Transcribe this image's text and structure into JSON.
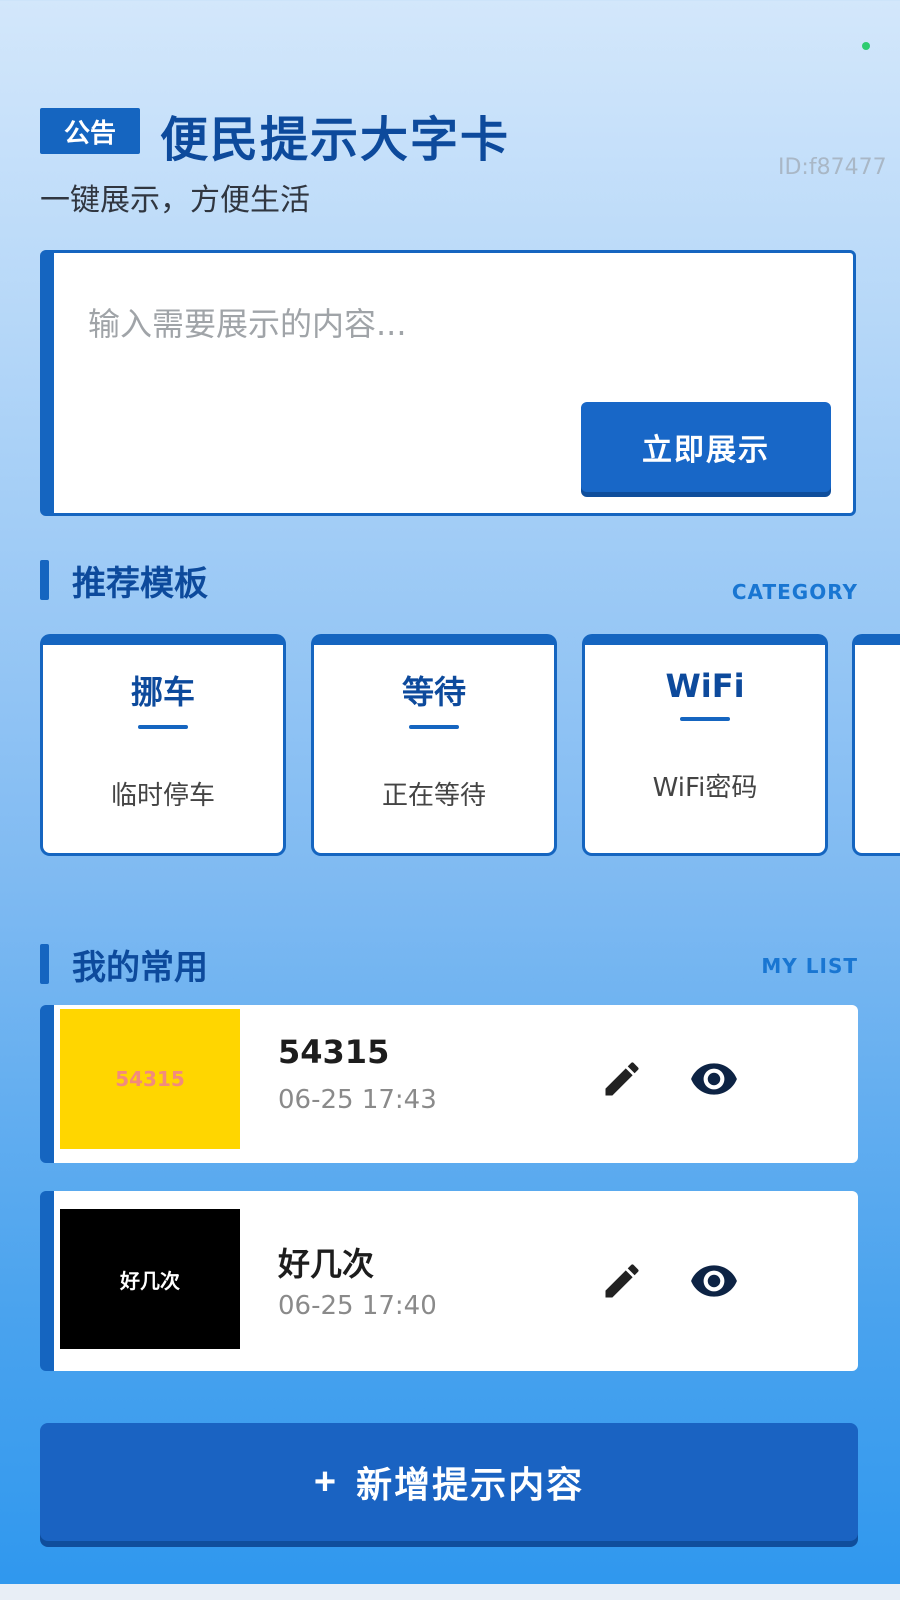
{
  "header": {
    "badge": "公告",
    "title": "便民提示大字卡",
    "subtitle": "一键展示，方便生活",
    "id_text": "ID:f87477"
  },
  "input_card": {
    "placeholder": "输入需要展示的内容...",
    "value": "",
    "button_label": "立即展示"
  },
  "templates_section": {
    "title": "推荐模板",
    "link": "CATEGORY",
    "items": [
      {
        "title": "挪车",
        "desc": "临时停车"
      },
      {
        "title": "等待",
        "desc": "正在等待"
      },
      {
        "title": "WiFi",
        "desc": "WiFi密码"
      }
    ]
  },
  "favorites_section": {
    "title": "我的常用",
    "link": "MY LIST",
    "items": [
      {
        "thumb_text": "54315",
        "thumb_bg": "#ffd600",
        "thumb_color": "#f28b7d",
        "name": "54315",
        "time": "06-25 17:43",
        "edit_icon": "pencil-icon",
        "view_icon": "eye-icon"
      },
      {
        "thumb_text": "好几次",
        "thumb_bg": "#000000",
        "thumb_color": "#ffffff",
        "name": "好几次",
        "time": "06-25 17:40",
        "edit_icon": "pencil-icon",
        "view_icon": "eye-icon"
      }
    ]
  },
  "add_button": {
    "plus": "+",
    "label": "新增提示内容"
  },
  "colors": {
    "primary": "#1565c0",
    "title": "#0d4a9c",
    "status_dot": "#2ecc71"
  }
}
